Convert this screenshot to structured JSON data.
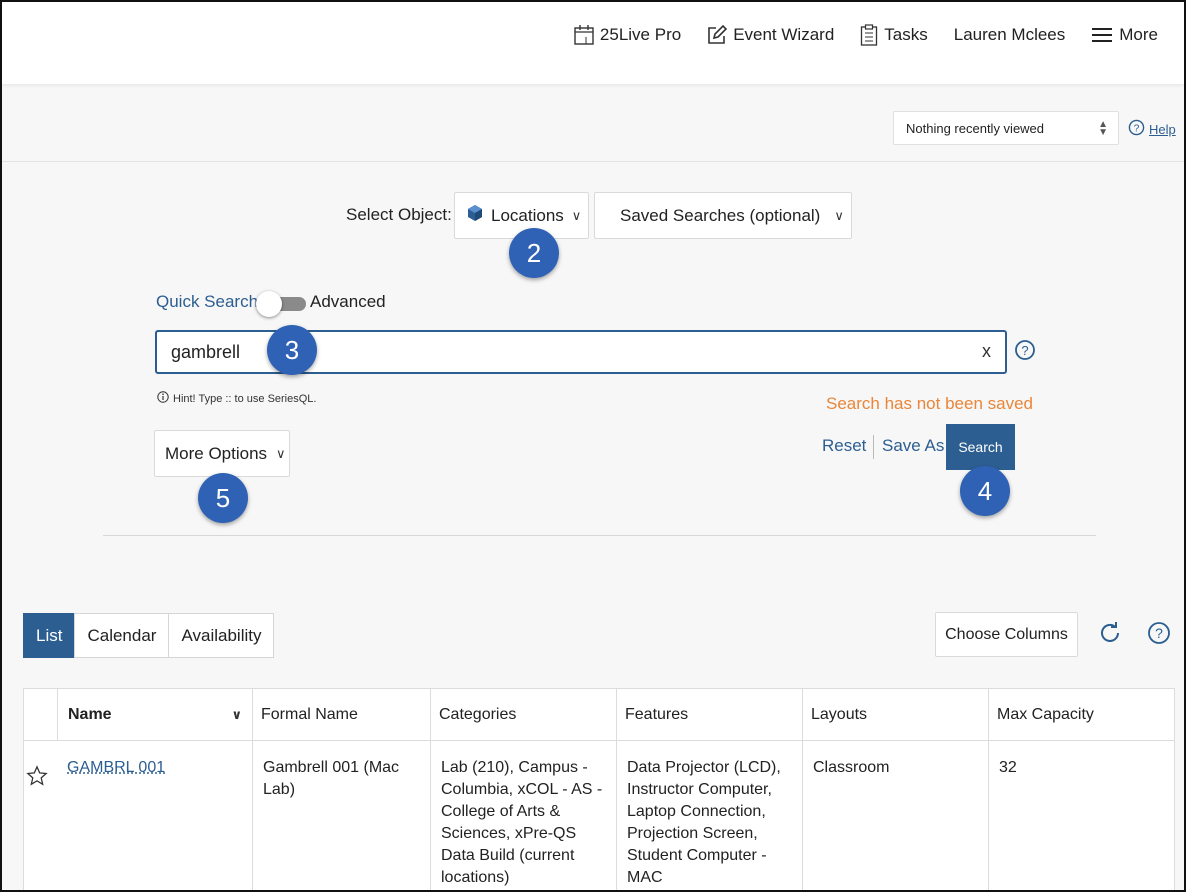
{
  "topnav": {
    "pro_label": "25Live Pro",
    "wizard_label": "Event Wizard",
    "tasks_label": "Tasks",
    "user_name": "Lauren Mclees",
    "more_label": "More"
  },
  "recent": {
    "selected": "Nothing recently viewed",
    "help_label": "Help"
  },
  "search": {
    "select_object_label": "Select Object:",
    "object_value": "Locations",
    "saved_searches_value": "Saved Searches (optional)",
    "quick_label": "Quick Search",
    "advanced_label": "Advanced",
    "query_value": "gambrell",
    "clear_label": "x",
    "hint": "Hint! Type :: to use SeriesQL.",
    "status": "Search has not been saved",
    "reset_label": "Reset",
    "save_as_label": "Save As",
    "search_label": "Search",
    "more_options_label": "More Options"
  },
  "badges": [
    "2",
    "3",
    "4",
    "5"
  ],
  "views": {
    "tabs": [
      "List",
      "Calendar",
      "Availability"
    ],
    "active": "List",
    "choose_columns_label": "Choose Columns"
  },
  "table": {
    "columns": [
      "Name",
      "Formal Name",
      "Categories",
      "Features",
      "Layouts",
      "Max Capacity"
    ],
    "rows": [
      {
        "name": "GAMBRL 001",
        "formal_name": "Gambrell 001 (Mac Lab)",
        "categories": "Lab (210), Campus - Columbia, xCOL - AS - College of Arts & Sciences, xPre-QS Data Build (current locations)",
        "features": "Data Projector (LCD), Instructor Computer, Laptop Connection, Projection Screen, Student Computer - MAC",
        "layouts": "Classroom",
        "max_capacity": "32"
      }
    ]
  },
  "colors": {
    "brand": "#2c5e91",
    "badge": "#2f62b4",
    "warning": "#e8863a"
  }
}
